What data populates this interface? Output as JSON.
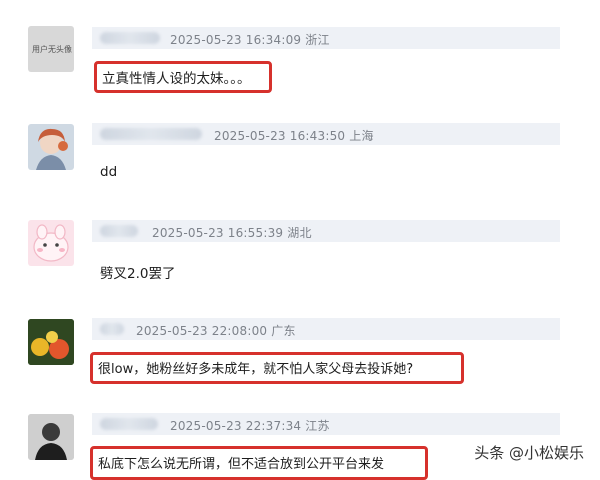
{
  "comments": [
    {
      "date": "2025-05-23",
      "time": "16:34:09",
      "location": "浙江",
      "text": "立真性情人设的太妹。。。",
      "highlighted": true,
      "avatar_caption": "用户无头像",
      "avatar": "gray-square"
    },
    {
      "date": "2025-05-23",
      "time": "16:43:50",
      "location": "上海",
      "text": "dd",
      "highlighted": false,
      "avatar": "illustrated-girl"
    },
    {
      "date": "2025-05-23",
      "time": "16:55:39",
      "location": "湖北",
      "text": "劈叉2.0罢了",
      "highlighted": false,
      "avatar": "pink-cartoon"
    },
    {
      "date": "2025-05-23",
      "time": "22:08:00",
      "location": "广东",
      "text": "很low，她粉丝好多未成年，就不怕人家父母去投诉她?",
      "highlighted": true,
      "avatar": "fruit-photo"
    },
    {
      "date": "2025-05-23",
      "time": "22:37:34",
      "location": "江苏",
      "text": "私底下怎么说无所谓，但不适合放到公开平台来发",
      "highlighted": true,
      "avatar": "dark-person"
    }
  ],
  "highlight_color": "#d6312c",
  "watermark": {
    "text": "头条 @小松娱乐"
  }
}
